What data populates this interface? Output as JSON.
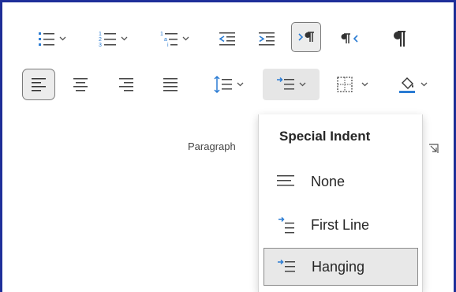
{
  "ribbon": {
    "group_label": "Paragraph",
    "row1": [
      {
        "name": "bullets-button",
        "icon": "bullet-list-icon",
        "dropdown": true
      },
      {
        "name": "numbering-button",
        "icon": "numbered-list-icon",
        "dropdown": true
      },
      {
        "name": "multilevel-list-button",
        "icon": "multilevel-list-icon",
        "dropdown": true
      },
      {
        "name": "decrease-indent-button",
        "icon": "decrease-indent-icon",
        "dropdown": false
      },
      {
        "name": "increase-indent-button",
        "icon": "increase-indent-icon",
        "dropdown": false
      },
      {
        "name": "ltr-text-button",
        "icon": "ltr-paragraph-icon",
        "dropdown": false,
        "pressed": true
      },
      {
        "name": "rtl-text-button",
        "icon": "rtl-paragraph-icon",
        "dropdown": false
      },
      {
        "name": "show-formatting-button",
        "icon": "pilcrow-icon",
        "dropdown": false
      }
    ],
    "row2": [
      {
        "name": "align-left-button",
        "icon": "align-left-icon",
        "pressed": true
      },
      {
        "name": "align-center-button",
        "icon": "align-center-icon"
      },
      {
        "name": "align-right-button",
        "icon": "align-right-icon"
      },
      {
        "name": "justify-button",
        "icon": "justify-icon"
      },
      {
        "name": "line-spacing-button",
        "icon": "line-spacing-icon",
        "dropdown": true
      },
      {
        "name": "special-indent-button",
        "icon": "hanging-indent-icon",
        "dropdown": true,
        "active": true
      },
      {
        "name": "borders-button",
        "icon": "borders-icon",
        "dropdown": true
      },
      {
        "name": "shading-button",
        "icon": "paint-bucket-icon",
        "dropdown": true,
        "accent": "#2b7cd3"
      }
    ]
  },
  "special_indent_menu": {
    "title": "Special Indent",
    "items": [
      {
        "label": "None",
        "icon": "no-indent-icon",
        "selected": false
      },
      {
        "label": "First Line",
        "icon": "first-line-indent-icon",
        "selected": false
      },
      {
        "label": "Hanging",
        "icon": "hanging-indent-icon",
        "selected": true
      }
    ]
  },
  "colors": {
    "frame": "#1f2f9a",
    "icon_blue": "#2b7cd3",
    "icon_gray": "#444444"
  }
}
